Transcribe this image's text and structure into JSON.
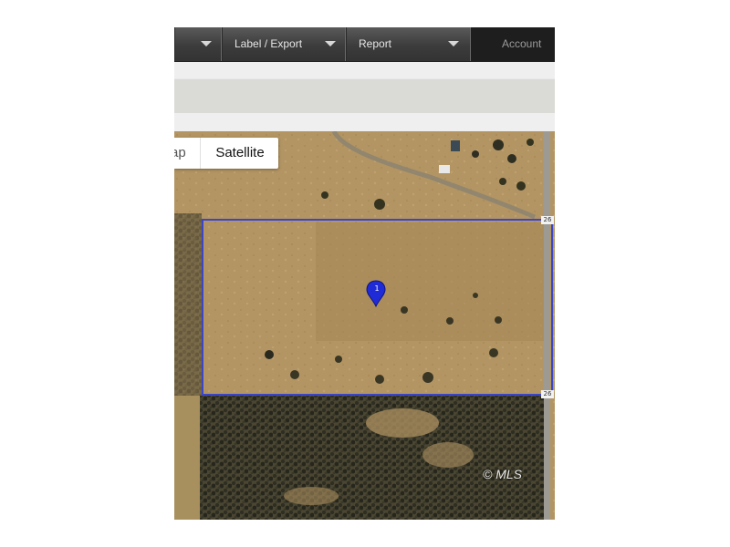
{
  "toolbar": {
    "menus": [
      {
        "label": ""
      },
      {
        "label": "Label / Export"
      },
      {
        "label": "Report"
      }
    ],
    "account_label": "Account"
  },
  "map": {
    "type_options": {
      "map_label_partial": "ap",
      "satellite_label": "Satellite",
      "selected": "Satellite"
    },
    "marker_number": "1",
    "road_shield_top": "26",
    "road_shield_bottom": "26",
    "copyright": "© MLS",
    "colors": {
      "parcel_outline": "#3b45c8",
      "marker": "#1f2bd6",
      "terrain": "#b39563",
      "forest": "#3a3a2a"
    }
  }
}
